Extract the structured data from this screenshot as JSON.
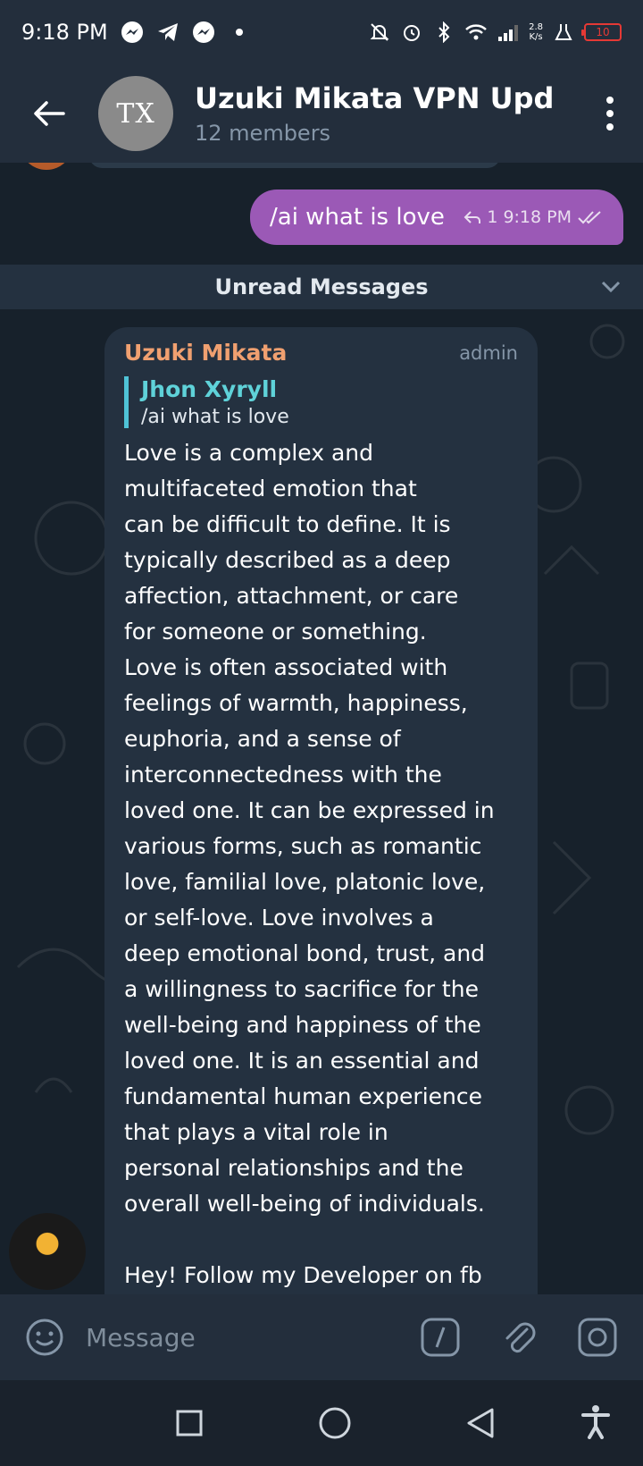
{
  "status_bar": {
    "time": "9:18 PM",
    "net_speed_value": "2.8",
    "net_speed_unit": "K/s",
    "battery": "10",
    "icons": [
      "messenger-icon",
      "telegram-icon",
      "messenger-icon",
      "dot-icon",
      "mute-notification-icon",
      "alarm-icon",
      "bluetooth-icon",
      "wifi-icon",
      "signal-icon",
      "lab-icon",
      "battery-icon"
    ]
  },
  "header": {
    "avatar_text": "TX",
    "title": "Uzuki Mikata VPN Updat",
    "subtitle": "12 members"
  },
  "outgoing": {
    "text": "/ai what is love",
    "reply_count": "1",
    "time": "9:18 PM"
  },
  "unread_bar": {
    "label": "Unread Messages"
  },
  "incoming": {
    "sender": "Uzuki Mikata",
    "role": "admin",
    "reply_name": "Jhon Xyryll",
    "reply_text": "/ai what is love",
    "body": "Love is a complex and\nmultifaceted emotion that\ncan be difficult to define. It is\ntypically described as a deep\naffection, attachment, or care\nfor someone or something.\nLove is often associated with\nfeelings of warmth, happiness,\neuphoria, and a sense of\ninterconnectedness with the\nloved one. It can be expressed in\nvarious forms, such as romantic\nlove, familial love, platonic love,\nor self-love. Love involves a\ndeep emotional bond, trust, and\na willingness to sacrifice for the\nwell-being and happiness of the\nloved one. It is an essential and\nfundamental human experience\nthat plays a vital role in\npersonal relationships and the\noverall well-being of individuals.",
    "footer": "Hey! Follow my Developer on fb"
  },
  "input": {
    "placeholder": "Message"
  },
  "colors": {
    "accent_purple": "#9b59b6",
    "sender_orange": "#f0a070",
    "reply_cyan": "#5fd2d9",
    "header_bg": "#232e3c",
    "chat_bg": "#17212b"
  }
}
